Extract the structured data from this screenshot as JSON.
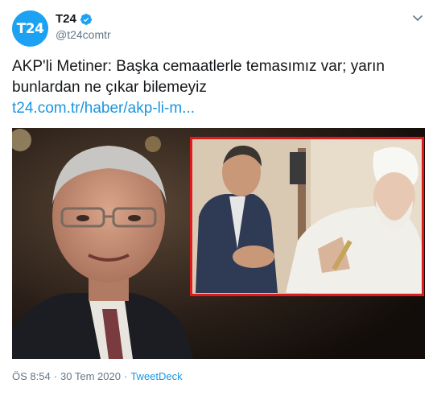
{
  "account": {
    "avatar_text": "T24",
    "display_name": "T24",
    "handle": "@t24comtr",
    "verified": true,
    "brand_color": "#1da1f2"
  },
  "tweet": {
    "text": "AKP'li Metiner: Başka cemaatlerle temasımız var; yarın bunlardan ne çıkar bilemeyiz",
    "link": "t24.com.tr/haber/akp-li-m..."
  },
  "media": {
    "highlight_border_color": "#e0191d"
  },
  "footer": {
    "time": "ÖS 8:54",
    "separator": "·",
    "date": "30 Tem 2020",
    "separator2": "·",
    "client": "TweetDeck"
  },
  "icons": {
    "menu": "chevron-down-icon",
    "verified": "verified-badge-icon"
  }
}
